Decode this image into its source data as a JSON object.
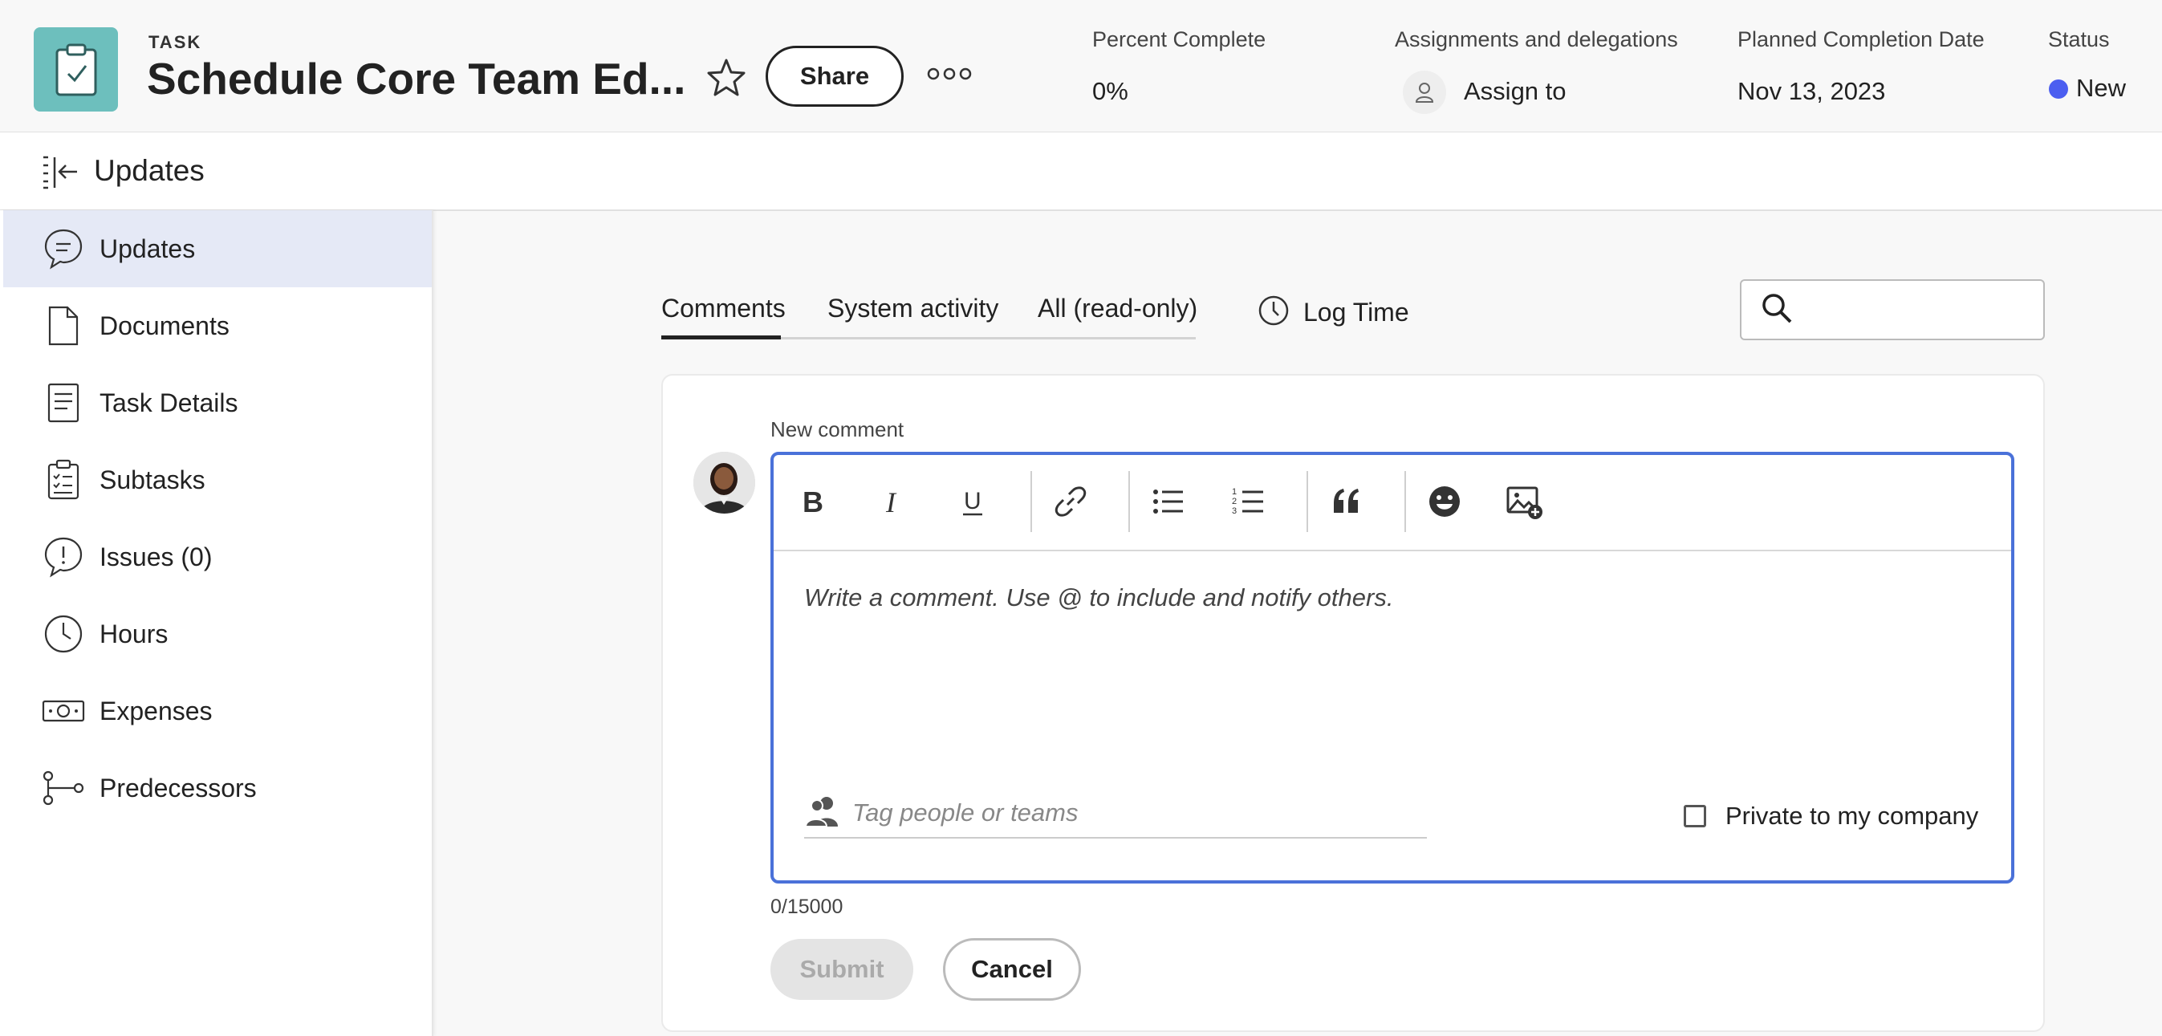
{
  "header": {
    "task_type": "TASK",
    "task_title": "Schedule Core Team Ed...",
    "share_label": "Share",
    "percent_complete_label": "Percent Complete",
    "percent_complete_value": "0%",
    "assignments_label": "Assignments and delegations",
    "assign_to_label": "Assign to",
    "planned_completion_label": "Planned Completion Date",
    "planned_completion_value": "Nov 13, 2023",
    "status_label": "Status",
    "status_value": "New",
    "status_color": "#4b5ef0",
    "task_icon_color": "#6dbfbd"
  },
  "panel": {
    "title": "Updates"
  },
  "sidebar": {
    "items": [
      {
        "label": "Updates",
        "icon": "speech-bubble-icon",
        "active": true
      },
      {
        "label": "Documents",
        "icon": "document-icon",
        "active": false
      },
      {
        "label": "Task Details",
        "icon": "task-details-icon",
        "active": false
      },
      {
        "label": "Subtasks",
        "icon": "clipboard-checklist-icon",
        "active": false
      },
      {
        "label": "Issues (0)",
        "icon": "alert-bubble-icon",
        "active": false
      },
      {
        "label": "Hours",
        "icon": "clock-icon",
        "active": false
      },
      {
        "label": "Expenses",
        "icon": "money-icon",
        "active": false
      },
      {
        "label": "Predecessors",
        "icon": "dependency-icon",
        "active": false
      }
    ]
  },
  "tabs": {
    "items": [
      {
        "label": "Comments",
        "active": true
      },
      {
        "label": "System activity",
        "active": false
      },
      {
        "label": "All (read-only)",
        "active": false
      }
    ],
    "log_time_label": "Log Time"
  },
  "search": {
    "placeholder": ""
  },
  "comment": {
    "new_comment_label": "New comment",
    "placeholder": "Write a comment. Use @ to include and notify others.",
    "tag_placeholder": "Tag people or teams",
    "private_label": "Private to my company",
    "private_checked": false,
    "char_count": "0/15000",
    "submit_label": "Submit",
    "cancel_label": "Cancel",
    "editor_border_color": "#4a71d9",
    "toolbar": [
      "bold-icon",
      "italic-icon",
      "underline-icon",
      "link-icon",
      "bullet-list-icon",
      "numbered-list-icon",
      "quote-icon",
      "emoji-icon",
      "insert-image-icon"
    ]
  }
}
